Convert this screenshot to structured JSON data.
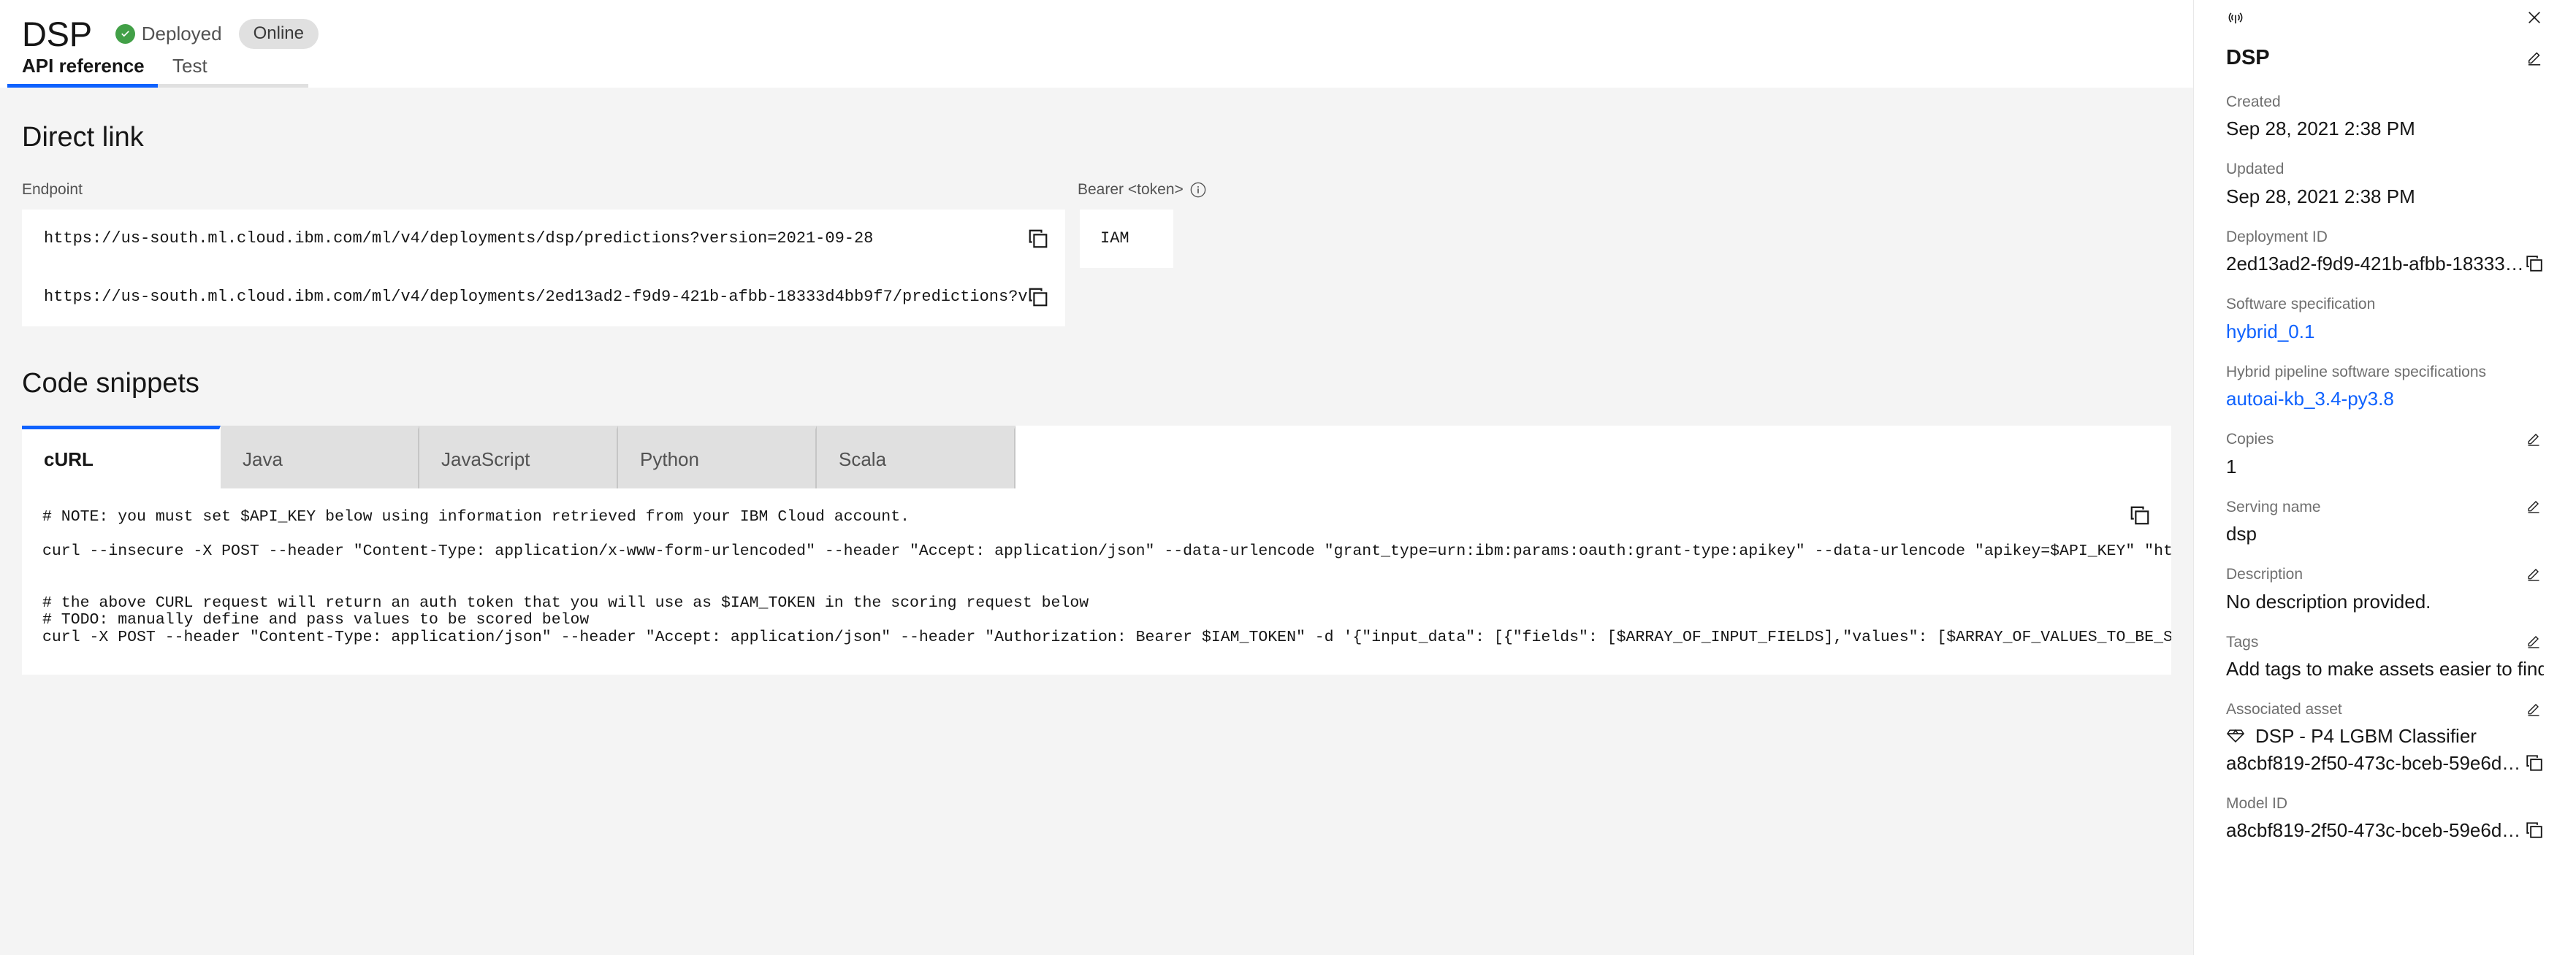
{
  "header": {
    "title": "DSP",
    "status_label": "Deployed",
    "state_badge": "Online",
    "status_color": "#42a047",
    "accent_color": "#0f62fe"
  },
  "tabs": [
    {
      "label": "API reference",
      "active": true
    },
    {
      "label": "Test",
      "active": false
    }
  ],
  "direct_link": {
    "section_title": "Direct link",
    "endpoint_label": "Endpoint",
    "bearer_label": "Bearer <token>",
    "bearer_value": "IAM",
    "endpoints": [
      "https://us-south.ml.cloud.ibm.com/ml/v4/deployments/dsp/predictions?version=2021-09-28",
      "https://us-south.ml.cloud.ibm.com/ml/v4/deployments/2ed13ad2-f9d9-421b-afbb-18333d4bb9f7/predictions?versio"
    ]
  },
  "code_snippets": {
    "section_title": "Code snippets",
    "tabs": [
      {
        "label": "cURL",
        "active": true
      },
      {
        "label": "Java",
        "active": false
      },
      {
        "label": "JavaScript",
        "active": false
      },
      {
        "label": "Python",
        "active": false
      },
      {
        "label": "Scala",
        "active": false
      }
    ],
    "lines": [
      "# NOTE: you must set $API_KEY below using information retrieved from your IBM Cloud account.",
      "",
      "curl --insecure -X POST --header \"Content-Type: application/x-www-form-urlencoded\" --header \"Accept: application/json\" --data-urlencode \"grant_type=urn:ibm:params:oauth:grant-type:apikey\" --data-urlencode \"apikey=$API_KEY\" \"https:/",
      "",
      "# the above CURL request will return an auth token that you will use as $IAM_TOKEN in the scoring request below",
      "# TODO: manually define and pass values to be scored below",
      "curl -X POST --header \"Content-Type: application/json\" --header \"Accept: application/json\" --header \"Authorization: Bearer $IAM_TOKEN\" -d '{\"input_data\": [{\"fields\": [$ARRAY_OF_INPUT_FIELDS],\"values\": [$ARRAY_OF_VALUES_TO_BE_SCORED"
    ]
  },
  "details_panel": {
    "name": "DSP",
    "fields": {
      "created_label": "Created",
      "created_value": "Sep 28, 2021 2:38 PM",
      "updated_label": "Updated",
      "updated_value": "Sep 28, 2021 2:38 PM",
      "deployment_id_label": "Deployment ID",
      "deployment_id_value": "2ed13ad2-f9d9-421b-afbb-18333…",
      "software_spec_label": "Software specification",
      "software_spec_value": "hybrid_0.1",
      "hybrid_pipeline_label": "Hybrid pipeline software specifications",
      "hybrid_pipeline_value": "autoai-kb_3.4-py3.8",
      "copies_label": "Copies",
      "copies_value": "1",
      "serving_name_label": "Serving name",
      "serving_name_value": "dsp",
      "description_label": "Description",
      "description_value": "No description provided.",
      "tags_label": "Tags",
      "tags_value": "Add tags to make assets easier to find.",
      "associated_asset_label": "Associated asset",
      "associated_asset_value": "DSP - P4 LGBM Classifier",
      "associated_asset_id": "a8cbf819-2f50-473c-bceb-59e6d…",
      "model_id_label": "Model ID",
      "model_id_value": "a8cbf819-2f50-473c-bceb-59e6d…"
    },
    "link_color": "#0f62fe"
  }
}
